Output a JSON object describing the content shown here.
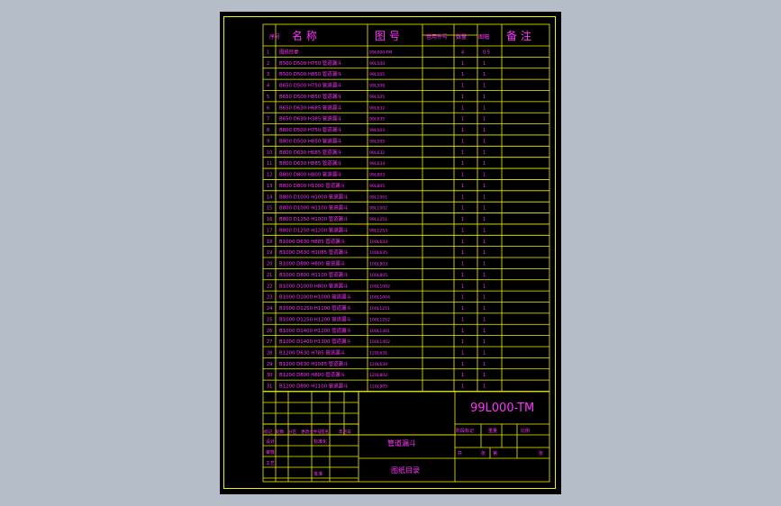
{
  "header": {
    "col_no": "序号",
    "col_name": "名    称",
    "col_drawing": "图  号",
    "col_reuse": "借用件号",
    "col_qty": "数量",
    "col_size": "图幅",
    "col_note": "备  注"
  },
  "rows": [
    {
      "no": "1",
      "name": "图纸目录",
      "code": "99L000-TM",
      "qty": "4",
      "size": "0.5"
    },
    {
      "no": "2",
      "name": "B500 D500 H750 管道漏斗",
      "code": "99L500",
      "qty": "1",
      "size": "1"
    },
    {
      "no": "3",
      "name": "B500 D500 H850 管道漏斗",
      "code": "99L505",
      "qty": "1",
      "size": "1"
    },
    {
      "no": "4",
      "name": "B650 D500 H750 管道漏斗",
      "code": "99L508",
      "qty": "1",
      "size": "1"
    },
    {
      "no": "5",
      "name": "B650 D500 H850 管道漏斗",
      "code": "99L505",
      "qty": "1",
      "size": "1"
    },
    {
      "no": "6",
      "name": "B650 D630 H685 管道漏斗",
      "code": "99L632",
      "qty": "1",
      "size": "1"
    },
    {
      "no": "7",
      "name": "B650 D630 H385 管道漏斗",
      "code": "99L635",
      "qty": "1",
      "size": "1"
    },
    {
      "no": "8",
      "name": "B800 D500 H750 管道漏斗",
      "code": "99L503",
      "qty": "1",
      "size": "1"
    },
    {
      "no": "9",
      "name": "B800 D500 H850 管道漏斗",
      "code": "99L505",
      "qty": "1",
      "size": "1"
    },
    {
      "no": "10",
      "name": "B800 D630 H685 管道漏斗",
      "code": "99L632",
      "qty": "1",
      "size": "1"
    },
    {
      "no": "11",
      "name": "B800 D630 H885 管道漏斗",
      "code": "99L634",
      "qty": "1",
      "size": "1"
    },
    {
      "no": "12",
      "name": "B800 D800 H800 管道漏斗",
      "code": "99L803",
      "qty": "1",
      "size": "1"
    },
    {
      "no": "13",
      "name": "B800 D800 H1000 管道漏斗",
      "code": "99L805",
      "qty": "1",
      "size": "1"
    },
    {
      "no": "14",
      "name": "B800 D1000 H1000 管道漏斗",
      "code": "99L1001",
      "qty": "1",
      "size": "1"
    },
    {
      "no": "15",
      "name": "B800 D1000 H1100 管道漏斗",
      "code": "99L1002",
      "qty": "1",
      "size": "1"
    },
    {
      "no": "16",
      "name": "B800 D1250 H1000 管道漏斗",
      "code": "99L1251",
      "qty": "1",
      "size": "1"
    },
    {
      "no": "17",
      "name": "B800 D1250 H1200 管道漏斗",
      "code": "99L1253",
      "qty": "1",
      "size": "1"
    },
    {
      "no": "18",
      "name": "B1000 D630 H885 管道漏斗",
      "code": "100L633",
      "qty": "1",
      "size": "1"
    },
    {
      "no": "19",
      "name": "B1000 D630 H1085 管道漏斗",
      "code": "100L635",
      "qty": "1",
      "size": "1"
    },
    {
      "no": "20",
      "name": "B1000 D800 H800 管道漏斗",
      "code": "100L803",
      "qty": "1",
      "size": "1"
    },
    {
      "no": "21",
      "name": "B1000 D800 H1100 管道漏斗",
      "code": "100L805",
      "qty": "1",
      "size": "1"
    },
    {
      "no": "22",
      "name": "B1000 D1000 H800 管道漏斗",
      "code": "100L1002",
      "qty": "1",
      "size": "1"
    },
    {
      "no": "23",
      "name": "B1000 D1000 H1000 管道漏斗",
      "code": "100L1004",
      "qty": "1",
      "size": "1"
    },
    {
      "no": "24",
      "name": "B1000 D1250 H1100 管道漏斗",
      "code": "100L1251",
      "qty": "1",
      "size": "1"
    },
    {
      "no": "25",
      "name": "B1000 D1250 H1200 管道漏斗",
      "code": "100L1252",
      "qty": "1",
      "size": "1"
    },
    {
      "no": "26",
      "name": "B1000 D1400 H1200 管道漏斗",
      "code": "100L1401",
      "qty": "1",
      "size": "1"
    },
    {
      "no": "27",
      "name": "B1000 D1400 H1300 管道漏斗",
      "code": "100L1402",
      "qty": "1",
      "size": "1"
    },
    {
      "no": "28",
      "name": "B1200 D630 H785 管道漏斗",
      "code": "120L631",
      "qty": "1",
      "size": "1"
    },
    {
      "no": "29",
      "name": "B1200 D630 H1085 管道漏斗",
      "code": "120L634",
      "qty": "1",
      "size": "1"
    },
    {
      "no": "30",
      "name": "B1200 D800 H800 管道漏斗",
      "code": "120L802",
      "qty": "1",
      "size": "1"
    },
    {
      "no": "31",
      "name": "B1200 D800 H1100 管道漏斗",
      "code": "120L805",
      "qty": "1",
      "size": "1"
    }
  ],
  "title_block": {
    "drawing_number": "99L000-TM",
    "product_name": "管道漏斗",
    "doc_title": "图纸目录",
    "revision_header": [
      "标记",
      "处数",
      "分区",
      "更改文件号",
      "签名",
      "年月日"
    ],
    "left_labels": [
      "设计",
      "审核",
      "工艺",
      "标准化",
      "批准"
    ],
    "stage_header": [
      "阶段标记",
      "重量",
      "比例"
    ],
    "sheet_info": [
      "共",
      "张",
      "第",
      "张"
    ]
  }
}
